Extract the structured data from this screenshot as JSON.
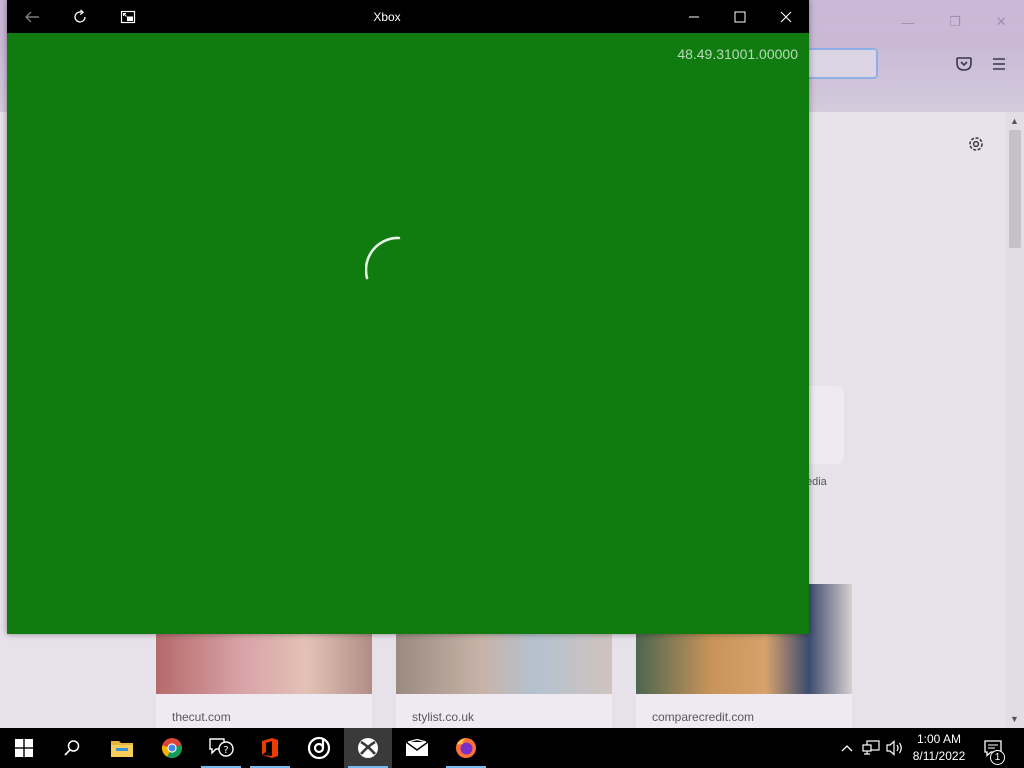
{
  "xbox": {
    "title": "Xbox",
    "version": "48.49.31001.00000"
  },
  "browser_background": {
    "shortcut_label_partial": "edia",
    "stories": [
      {
        "site": "thecut.com"
      },
      {
        "site": "stylist.co.uk"
      },
      {
        "site": "comparecredit.com"
      }
    ]
  },
  "taskbar": {
    "apps": [
      "start-icon",
      "search-icon",
      "file-explorer-icon",
      "chrome-icon",
      "feedback-hub-icon",
      "office-icon",
      "groove-icon",
      "xbox-icon",
      "mail-icon",
      "firefox-icon"
    ],
    "clock": {
      "time": "1:00 AM",
      "date": "8/11/2022"
    },
    "notification_count": "1"
  },
  "colors": {
    "xbox_green": "#107c10",
    "titlebar": "#000000",
    "taskbar": "#000000",
    "running_indicator": "#76b9ed"
  }
}
